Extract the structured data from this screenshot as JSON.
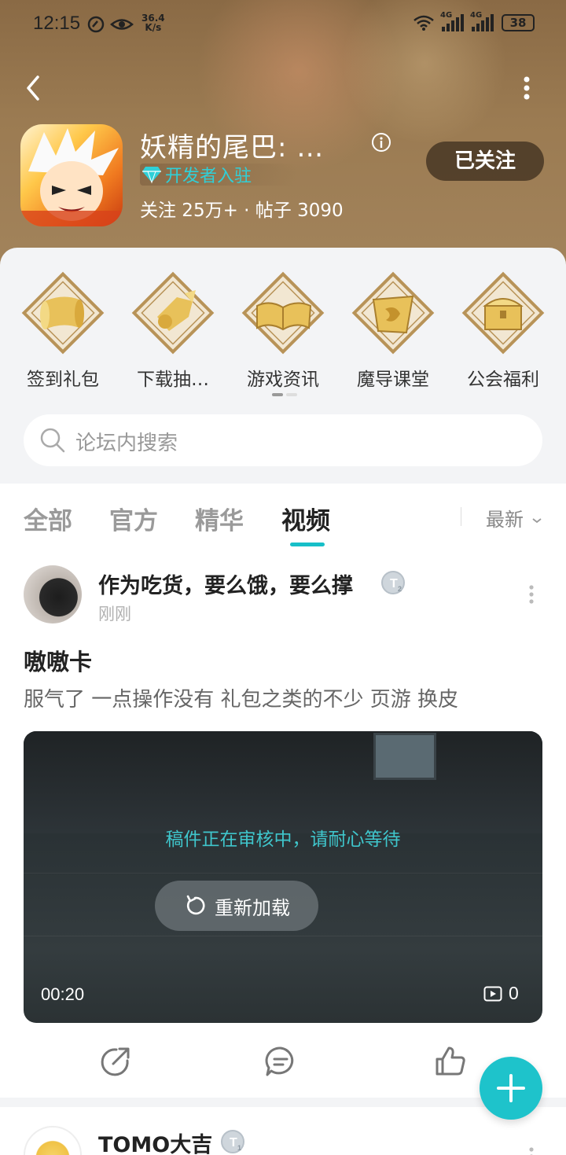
{
  "status_bar": {
    "time": "12:15",
    "net_speed_value": "36.4",
    "net_speed_unit": "K/s",
    "signal1_label": "4G",
    "signal2_label": "4G",
    "battery": "38"
  },
  "header": {
    "game_name": "妖精的尾巴: …",
    "developer_badge": "开发者入驻",
    "stats": "关注 25万+ · 帖子 3090",
    "follow_label": "已关注"
  },
  "features": [
    {
      "label": "签到礼包",
      "icon": "scroll-icon"
    },
    {
      "label": "下载抽…",
      "icon": "download-gift-icon"
    },
    {
      "label": "游戏资讯",
      "icon": "book-icon"
    },
    {
      "label": "魔导课堂",
      "icon": "guild-emblem-icon"
    },
    {
      "label": "公会福利",
      "icon": "treasure-chest-icon"
    }
  ],
  "search": {
    "placeholder": "论坛内搜索"
  },
  "tabs": [
    {
      "label": "全部",
      "active": false
    },
    {
      "label": "官方",
      "active": false
    },
    {
      "label": "精华",
      "active": false
    },
    {
      "label": "视频",
      "active": true
    }
  ],
  "sort_label": "最新",
  "post": {
    "author": "作为吃货，要么饿，要么撑",
    "time": "刚刚",
    "title": "嗷嗷卡",
    "body": "服气了 一点操作没有 礼包之类的不少 页游 换皮",
    "video": {
      "review_message": "稿件正在审核中，请耐心等待",
      "reload_label": "重新加载",
      "duration": "00:20",
      "play_count": "0"
    }
  },
  "next_post": {
    "author": "TOMO大吉"
  },
  "colors": {
    "accent": "#1ec3cb",
    "header_bg": "#9b7b52"
  }
}
